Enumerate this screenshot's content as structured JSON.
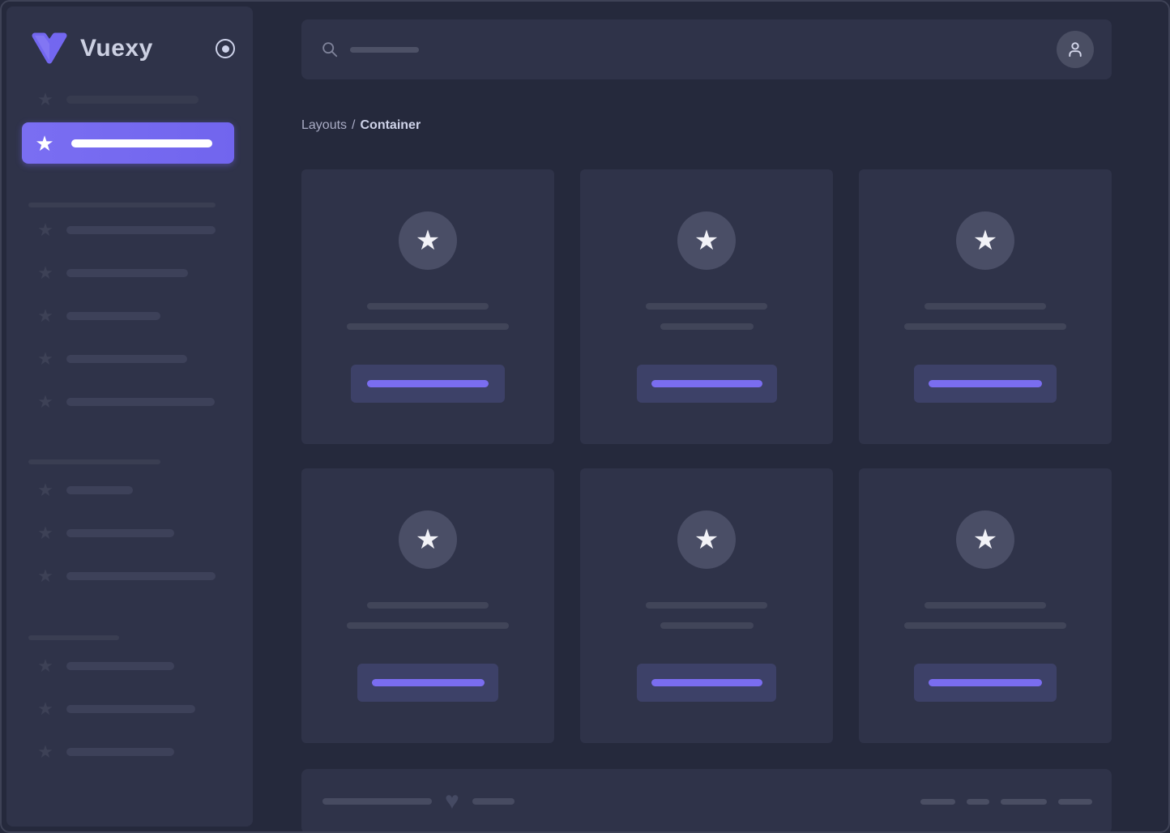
{
  "colors": {
    "background": "#25293c",
    "panel": "#2f3349",
    "accent_purple": "#7367f0",
    "skeleton_gray": "#3d4159",
    "circle_gray": "#4a4e66",
    "logo_text_color": "#ccd0e2"
  },
  "sidebar": {
    "logo": {
      "text": "Vuexy",
      "icon": "vuexy-v-logo"
    },
    "collapse_icon": "radio-dot-icon",
    "top_item": {
      "icon": "star-icon",
      "bar_style": "width:163px"
    },
    "active_item": {
      "icon": "star-icon",
      "bar_style": "width:174px"
    },
    "sections": [
      {
        "header_style": "width:231px",
        "items": [
          {
            "icon": "star-icon",
            "bar_style": "width:184px"
          },
          {
            "icon": "star-icon",
            "bar_style": "width:150px"
          },
          {
            "icon": "star-icon",
            "bar_style": "width:116px"
          },
          {
            "icon": "star-icon",
            "bar_style": "width:149px"
          },
          {
            "icon": "star-icon",
            "bar_style": "width:183px"
          }
        ]
      },
      {
        "header_style": "width:163px",
        "items": [
          {
            "icon": "star-icon",
            "bar_style": "width:82px"
          },
          {
            "icon": "star-icon",
            "bar_style": "width:133px"
          },
          {
            "icon": "star-icon",
            "bar_style": "width:184px"
          }
        ]
      },
      {
        "header_style": "width:112px",
        "items": [
          {
            "icon": "star-icon",
            "bar_style": "width:133px"
          },
          {
            "icon": "star-icon",
            "bar_style": "width:159px"
          },
          {
            "icon": "star-icon",
            "bar_style": "width:133px"
          }
        ]
      }
    ]
  },
  "header": {
    "search": {
      "icon": "search-icon",
      "placeholder_bar_style": "width:85px"
    },
    "user": {
      "icon": "person-icon"
    }
  },
  "breadcrumb": {
    "parent": "Layouts",
    "separator": "/",
    "current": "Container"
  },
  "cards": [
    {
      "icon": "star-icon",
      "line1_style": "width:150px",
      "line2_style": "width:200px",
      "button_style": "width:190px",
      "button_bar_style": "width:150px"
    },
    {
      "icon": "star-icon",
      "line1_style": "width:150px",
      "line2_style": "width:115px",
      "button_style": "width:173px",
      "button_bar_style": "width:137px"
    },
    {
      "icon": "star-icon",
      "line1_style": "width:150px",
      "line2_style": "width:200px",
      "button_style": "width:176px",
      "button_bar_style": "width:140px"
    },
    {
      "icon": "star-icon",
      "line1_style": "width:150px",
      "line2_style": "width:200px",
      "button_style": "width:174px",
      "button_bar_style": "width:139px"
    },
    {
      "icon": "star-icon",
      "line1_style": "width:150px",
      "line2_style": "width:115px",
      "button_style": "width:172px",
      "button_bar_style": "width:137px"
    },
    {
      "icon": "star-icon",
      "line1_style": "width:150px",
      "line2_style": "width:200px",
      "button_style": "width:176px",
      "button_bar_style": "width:140px"
    }
  ],
  "footer": {
    "left_bars": [
      "width:135px",
      "width:52px"
    ],
    "heart_icon": "heart-icon",
    "right_bars": [
      "width:43px",
      "width:28px",
      "width:57px",
      "width:42px"
    ]
  }
}
